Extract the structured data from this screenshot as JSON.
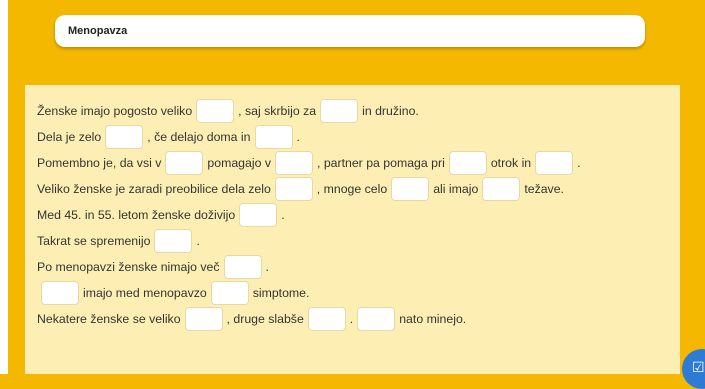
{
  "title": "Menopavza",
  "lines": [
    {
      "parts": [
        "Ženske imajo pogosto veliko",
        "",
        ", saj skrbijo za",
        "",
        "in družino."
      ]
    },
    {
      "parts": [
        "Dela je zelo",
        "",
        ", če delajo doma in",
        "",
        "."
      ]
    },
    {
      "parts": [
        "Pomembno je, da vsi v",
        "",
        "pomagajo v",
        "",
        ", partner pa pomaga pri",
        "",
        "otrok in",
        "",
        "."
      ]
    },
    {
      "parts": [
        "Veliko ženske je zaradi preobilice dela zelo",
        "",
        ", mnoge celo",
        "",
        "ali imajo",
        "",
        "težave."
      ]
    },
    {
      "parts": [
        "Med 45. in 55. letom ženske doživijo",
        "",
        "."
      ]
    },
    {
      "parts": [
        "Takrat se spremenijo",
        "",
        "."
      ]
    },
    {
      "parts": [
        "Po menopavzi ženske nimajo več",
        "",
        "."
      ]
    },
    {
      "parts": [
        "",
        "imajo med menopavzo",
        "",
        "simptome."
      ]
    },
    {
      "parts": [
        "Nekatere ženske se veliko",
        "",
        ", druge slabše",
        "",
        ".",
        "",
        "nato minejo."
      ]
    }
  ],
  "icons": {
    "check_button": "check-icon"
  },
  "colors": {
    "background": "#f5b800",
    "panel": "#fdefb4",
    "gap": "#ffffff",
    "button": "#2e7bd6"
  }
}
